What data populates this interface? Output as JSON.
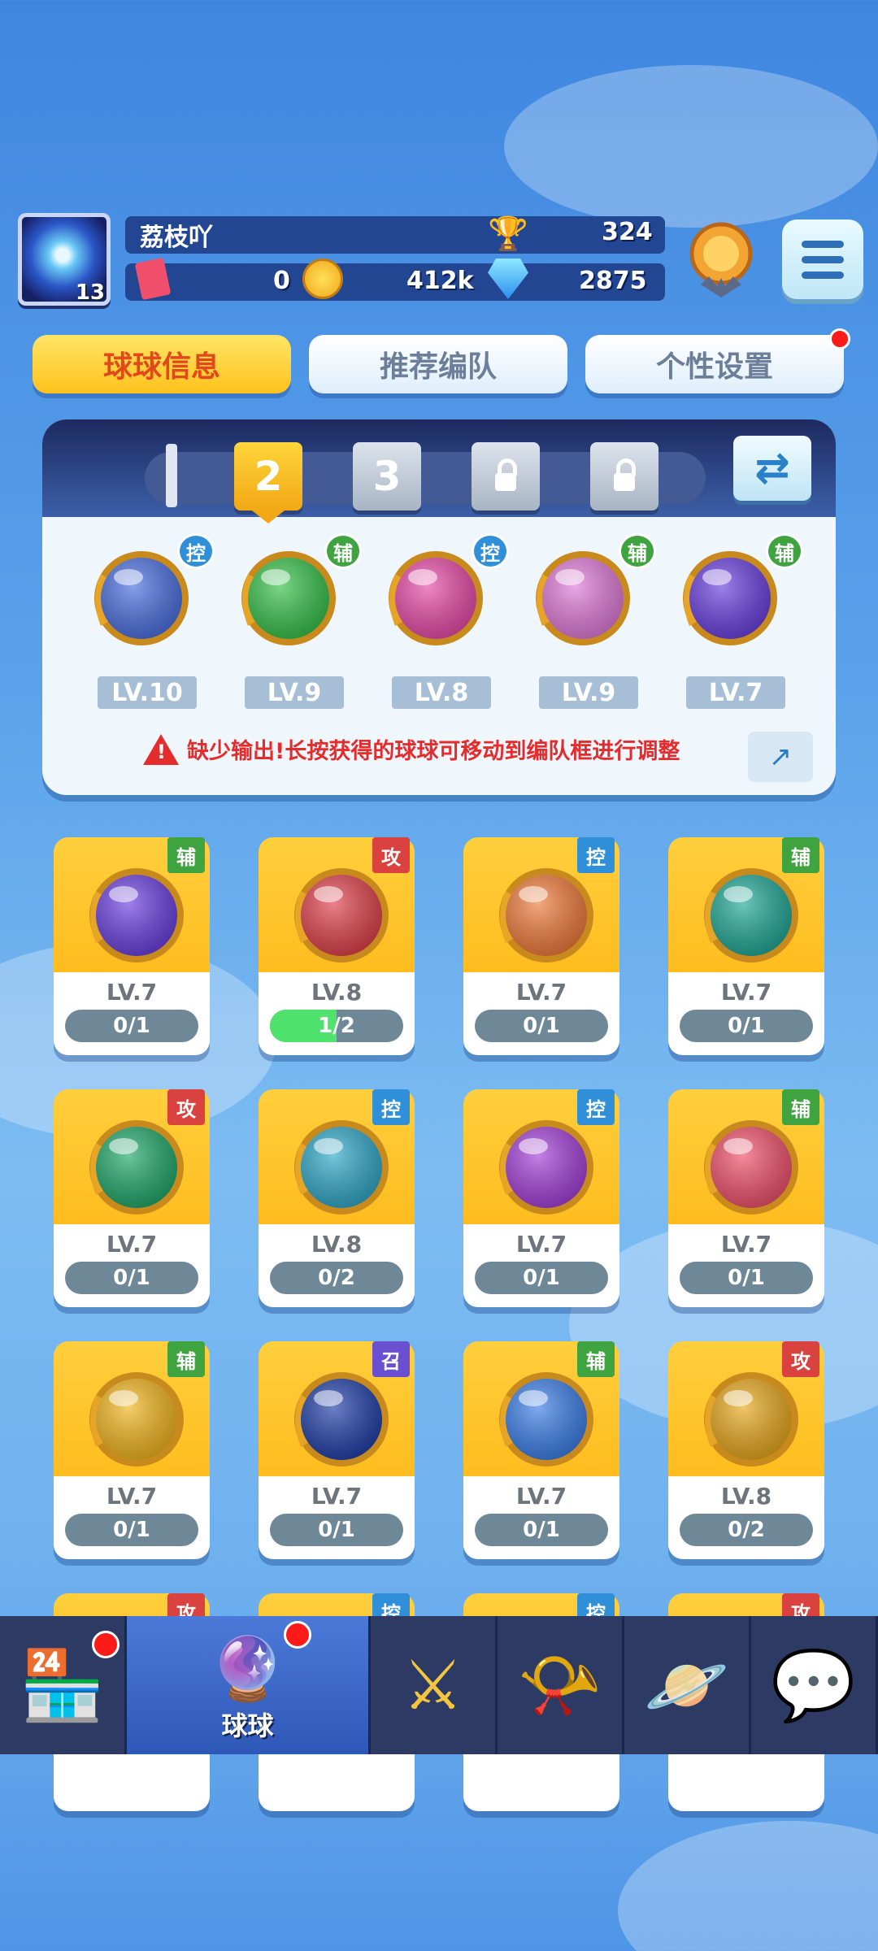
{
  "player": {
    "name": "荔枝吖",
    "level": "13",
    "trophies": "324",
    "tickets": "0",
    "coins": "412k",
    "diamonds": "2875"
  },
  "tabs": [
    {
      "label": "球球信息",
      "active": true
    },
    {
      "label": "推荐编队",
      "active": false
    },
    {
      "label": "个性设置",
      "active": false,
      "badge": true
    }
  ],
  "team": {
    "slots": [
      {
        "label": "",
        "state": "divider"
      },
      {
        "label": "2",
        "state": "selected"
      },
      {
        "label": "3",
        "state": "normal"
      },
      {
        "label": "",
        "state": "locked"
      },
      {
        "label": "",
        "state": "locked"
      }
    ],
    "balls": [
      {
        "role": "控",
        "level": "LV.10",
        "color": "#4a6ee0",
        "icon": "clock-icon"
      },
      {
        "role": "辅",
        "level": "LV.9",
        "color": "#36c24a",
        "icon": "arrow-icon"
      },
      {
        "role": "控",
        "level": "LV.8",
        "color": "#e84aa8",
        "icon": "blade-icon"
      },
      {
        "role": "辅",
        "level": "LV.9",
        "color": "#e07ad8",
        "icon": "crowd-icon"
      },
      {
        "role": "辅",
        "level": "LV.7",
        "color": "#6a3fe0",
        "icon": "lightning-icon"
      }
    ],
    "warning": "缺少输出!长按获得的球球可移动到编队框进行调整"
  },
  "cards": [
    {
      "role": "辅",
      "roleType": "aux",
      "level": "LV.7",
      "progress": "0/1",
      "fill": 0,
      "color": "#6a3fe0"
    },
    {
      "role": "攻",
      "roleType": "atk",
      "level": "LV.8",
      "progress": "1/2",
      "fill": 0.5,
      "color": "#e0404a"
    },
    {
      "role": "控",
      "roleType": "ctrl",
      "level": "LV.7",
      "progress": "0/1",
      "fill": 0,
      "color": "#f07a3a"
    },
    {
      "role": "辅",
      "roleType": "aux",
      "level": "LV.7",
      "progress": "0/1",
      "fill": 0,
      "color": "#1fa896"
    },
    {
      "role": "攻",
      "roleType": "atk",
      "level": "LV.7",
      "progress": "0/1",
      "fill": 0,
      "color": "#1fa86a"
    },
    {
      "role": "控",
      "roleType": "ctrl",
      "level": "LV.8",
      "progress": "0/2",
      "fill": 0,
      "color": "#2fa8c8"
    },
    {
      "role": "控",
      "roleType": "ctrl",
      "level": "LV.7",
      "progress": "0/1",
      "fill": 0,
      "color": "#a43fd8"
    },
    {
      "role": "辅",
      "roleType": "aux",
      "level": "LV.7",
      "progress": "0/1",
      "fill": 0,
      "color": "#f0506a"
    },
    {
      "role": "辅",
      "roleType": "aux",
      "level": "LV.7",
      "progress": "0/1",
      "fill": 0,
      "color": "#f2b51c"
    },
    {
      "role": "召",
      "roleType": "sum",
      "level": "LV.7",
      "progress": "0/1",
      "fill": 0,
      "color": "#1f3ea8"
    },
    {
      "role": "辅",
      "roleType": "aux",
      "level": "LV.7",
      "progress": "0/1",
      "fill": 0,
      "color": "#3a7ee8"
    },
    {
      "role": "攻",
      "roleType": "atk",
      "level": "LV.8",
      "progress": "0/2",
      "fill": 0,
      "color": "#e8a81c"
    },
    {
      "role": "攻",
      "roleType": "atk",
      "level": "",
      "progress": "",
      "fill": 0,
      "color": "#ffbc1e"
    },
    {
      "role": "控",
      "roleType": "ctrl",
      "level": "",
      "progress": "",
      "fill": 0,
      "color": "#ffbc1e"
    },
    {
      "role": "控",
      "roleType": "ctrl",
      "level": "",
      "progress": "",
      "fill": 0,
      "color": "#ffbc1e"
    },
    {
      "role": "攻",
      "roleType": "atk",
      "level": "",
      "progress": "",
      "fill": 0,
      "color": "#ffbc1e"
    }
  ],
  "nav": [
    {
      "name": "shop",
      "label": "",
      "icon": "shop-icon",
      "badge": true
    },
    {
      "name": "balls",
      "label": "球球",
      "icon": "balls-icon",
      "badge": true,
      "active": true
    },
    {
      "name": "battle",
      "label": "",
      "icon": "crossed-swords-icon"
    },
    {
      "name": "whistle",
      "label": "",
      "icon": "whistle-icon"
    },
    {
      "name": "planet",
      "label": "",
      "icon": "planet-icon"
    },
    {
      "name": "social",
      "label": "",
      "icon": "chat-heart-icon"
    }
  ]
}
